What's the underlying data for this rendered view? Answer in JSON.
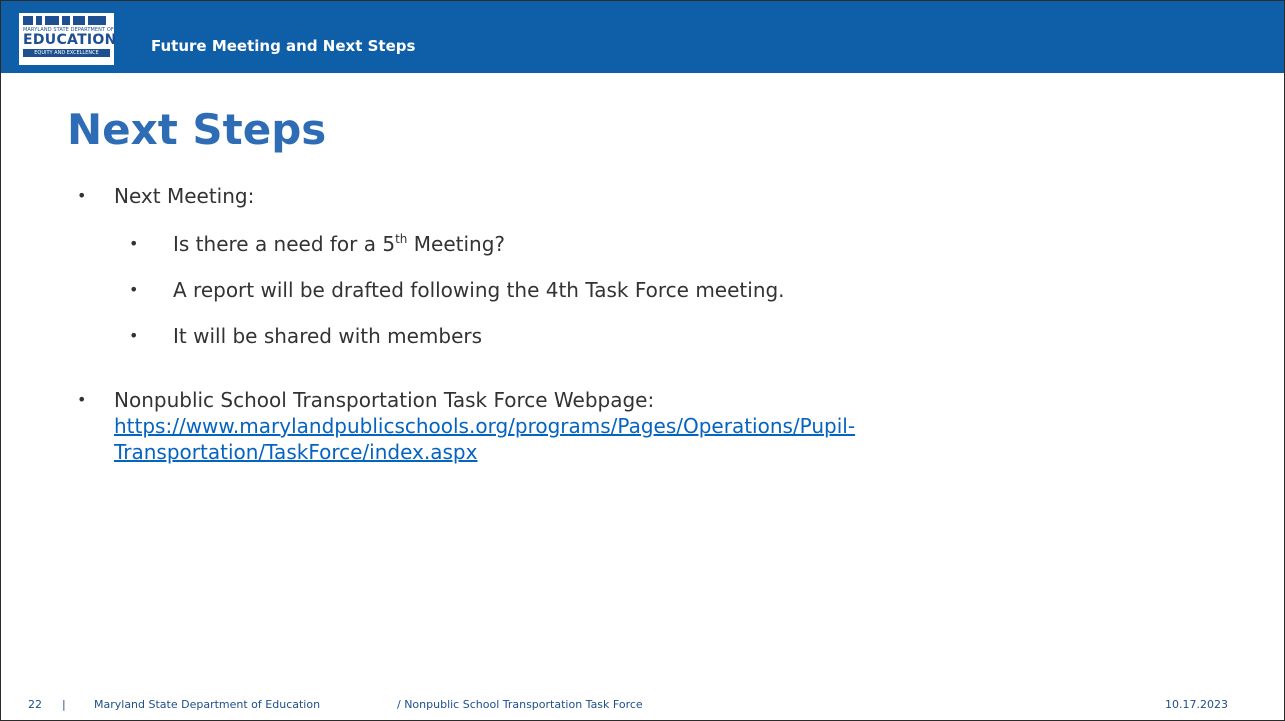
{
  "header": {
    "logo": {
      "top_text": "MARYLAND STATE DEPARTMENT OF",
      "main_text": "EDUCATION",
      "bottom_text": "EQUITY AND EXCELLENCE"
    },
    "title": "Future Meeting and Next Steps"
  },
  "slide": {
    "title": "Next Steps",
    "bullets": [
      {
        "text": "Next Meeting:"
      },
      {
        "text_before": "Is there a need for a 5",
        "sup": "th",
        "text_after": " Meeting?"
      },
      {
        "text": "A report will be drafted following the 4th Task Force meeting."
      },
      {
        "text": "It will be shared with members"
      },
      {
        "text": "Nonpublic School Transportation Task Force Webpage:"
      }
    ],
    "bullet_glyph": "•",
    "link": {
      "line1": "https://www.marylandpublicschools.org/programs/Pages/Operations/Pupil-",
      "line2": "Transportation/TaskForce/index.aspx"
    }
  },
  "footer": {
    "page_number": "22",
    "separator": "|",
    "org": "Maryland State Department of Education",
    "task_force": "/ Nonpublic School Transportation Task Force",
    "date": "10.17.2023"
  },
  "colors": {
    "header_bg": "#0f5fa8",
    "title": "#2e6db5",
    "link": "#0563c1",
    "footer_text": "#1e4e8c"
  }
}
